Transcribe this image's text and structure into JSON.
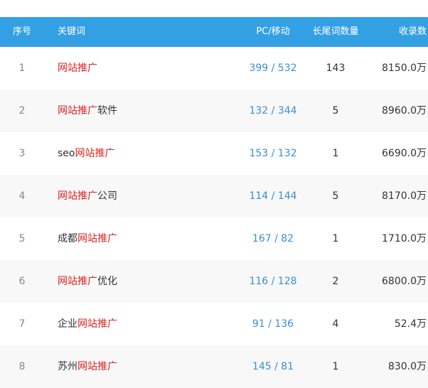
{
  "header": {
    "idx": "序号",
    "keyword": "关键词",
    "pc_mobile": "PC/移动",
    "longtail": "长尾词数量",
    "indexed": "收录数"
  },
  "rows": [
    {
      "idx": "1",
      "kw_pre": "",
      "kw_hl": "网站推广",
      "kw_post": "",
      "pc_mobile": "399 / 532",
      "longtail": "143",
      "indexed": "8150.0万"
    },
    {
      "idx": "2",
      "kw_pre": "",
      "kw_hl": "网站推广",
      "kw_post": "软件",
      "pc_mobile": "132 / 344",
      "longtail": "5",
      "indexed": "8960.0万"
    },
    {
      "idx": "3",
      "kw_pre": "seo",
      "kw_hl": "网站推广",
      "kw_post": "",
      "pc_mobile": "153 / 132",
      "longtail": "1",
      "indexed": "6690.0万"
    },
    {
      "idx": "4",
      "kw_pre": "",
      "kw_hl": "网站推广",
      "kw_post": "公司",
      "pc_mobile": "114 / 144",
      "longtail": "5",
      "indexed": "8170.0万"
    },
    {
      "idx": "5",
      "kw_pre": "成都",
      "kw_hl": "网站推广",
      "kw_post": "",
      "pc_mobile": "167 / 82",
      "longtail": "1",
      "indexed": "1710.0万"
    },
    {
      "idx": "6",
      "kw_pre": "",
      "kw_hl": "网站推广",
      "kw_post": "优化",
      "pc_mobile": "116 / 128",
      "longtail": "2",
      "indexed": "6800.0万"
    },
    {
      "idx": "7",
      "kw_pre": "企业",
      "kw_hl": "网站推广",
      "kw_post": "",
      "pc_mobile": "91 / 136",
      "longtail": "4",
      "indexed": "52.4万"
    },
    {
      "idx": "8",
      "kw_pre": "苏州",
      "kw_hl": "网站推广",
      "kw_post": "",
      "pc_mobile": "145 / 81",
      "longtail": "1",
      "indexed": "830.0万"
    }
  ],
  "colors": {
    "header_bg": "#34a0e4",
    "highlight": "#e0211f",
    "link_blue": "#3a8fd0",
    "alt_row": "#f8f8f8"
  }
}
